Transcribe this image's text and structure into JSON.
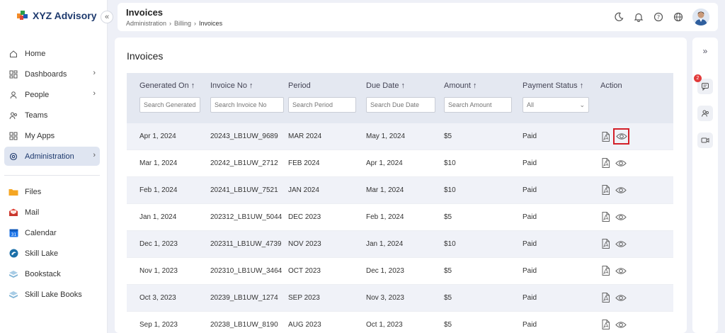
{
  "brand": {
    "name": "XYZ Advisory"
  },
  "sidebar": {
    "items": [
      {
        "label": "Home",
        "icon": "home-icon",
        "chevron": false
      },
      {
        "label": "Dashboards",
        "icon": "dashboard-icon",
        "chevron": true
      },
      {
        "label": "People",
        "icon": "people-icon",
        "chevron": true
      },
      {
        "label": "Teams",
        "icon": "teams-icon",
        "chevron": false
      },
      {
        "label": "My Apps",
        "icon": "apps-icon",
        "chevron": false
      },
      {
        "label": "Administration",
        "icon": "gear-icon",
        "chevron": true,
        "active": true
      }
    ],
    "apps": [
      {
        "label": "Files",
        "icon": "folder-icon",
        "color": "#f5a623"
      },
      {
        "label": "Mail",
        "icon": "mail-icon",
        "color": "#e0453a"
      },
      {
        "label": "Calendar",
        "icon": "calendar-icon",
        "color": "#1a73e8"
      },
      {
        "label": "Skill Lake",
        "icon": "skill-lake-icon",
        "color": "#1b6fa8"
      },
      {
        "label": "Bookstack",
        "icon": "bookstack-icon",
        "color": "#7fb3d5"
      },
      {
        "label": "Skill Lake Books",
        "icon": "books-icon",
        "color": "#7fb3d5"
      }
    ]
  },
  "header": {
    "title": "Invoices",
    "breadcrumb": [
      "Administration",
      "Billing",
      "Invoices"
    ]
  },
  "main": {
    "title": "Invoices",
    "columns": [
      {
        "label": "Generated On",
        "sort": "↑",
        "placeholder": "Search Generated I"
      },
      {
        "label": "Invoice No",
        "sort": "↑",
        "placeholder": "Search Invoice No"
      },
      {
        "label": "Period",
        "sort": "",
        "placeholder": "Search Period"
      },
      {
        "label": "Due Date",
        "sort": "↑",
        "placeholder": "Search Due Date"
      },
      {
        "label": "Amount",
        "sort": "↑",
        "placeholder": "Search Amount"
      },
      {
        "label": "Payment Status",
        "sort": "↑",
        "select_value": "All"
      },
      {
        "label": "Action",
        "sort": ""
      }
    ],
    "rows": [
      {
        "generated": "Apr 1, 2024",
        "invoice": "20243_LB1UW_9689",
        "period": "MAR 2024",
        "due": "May 1, 2024",
        "amount": "$5",
        "status": "Paid"
      },
      {
        "generated": "Mar 1, 2024",
        "invoice": "20242_LB1UW_2712",
        "period": "FEB 2024",
        "due": "Apr 1, 2024",
        "amount": "$10",
        "status": "Paid"
      },
      {
        "generated": "Feb 1, 2024",
        "invoice": "20241_LB1UW_7521",
        "period": "JAN 2024",
        "due": "Mar 1, 2024",
        "amount": "$10",
        "status": "Paid"
      },
      {
        "generated": "Jan 1, 2024",
        "invoice": "202312_LB1UW_5044",
        "period": "DEC 2023",
        "due": "Feb 1, 2024",
        "amount": "$5",
        "status": "Paid"
      },
      {
        "generated": "Dec 1, 2023",
        "invoice": "202311_LB1UW_4739",
        "period": "NOV 2023",
        "due": "Jan 1, 2024",
        "amount": "$10",
        "status": "Paid"
      },
      {
        "generated": "Nov 1, 2023",
        "invoice": "202310_LB1UW_3464",
        "period": "OCT 2023",
        "due": "Dec 1, 2023",
        "amount": "$5",
        "status": "Paid"
      },
      {
        "generated": "Oct 3, 2023",
        "invoice": "20239_LB1UW_1274",
        "period": "SEP 2023",
        "due": "Nov 3, 2023",
        "amount": "$5",
        "status": "Paid"
      },
      {
        "generated": "Sep 1, 2023",
        "invoice": "20238_LB1UW_8190",
        "period": "AUG 2023",
        "due": "Oct 1, 2023",
        "amount": "$5",
        "status": "Paid"
      }
    ]
  },
  "rail": {
    "chat_badge": "2"
  }
}
